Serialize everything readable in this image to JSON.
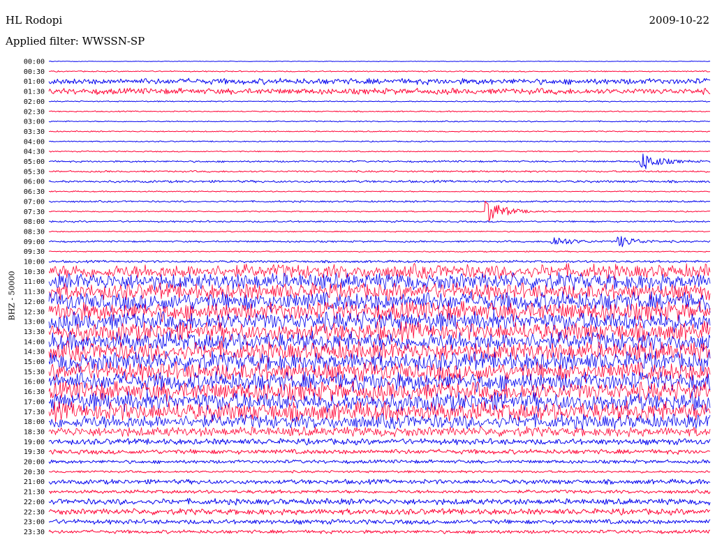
{
  "header": {
    "station": "HL Rodopi",
    "date": "2009-10-22",
    "filter": "Applied filter: WWSSN-SP",
    "channel": "BHZ - 50000"
  },
  "colors": {
    "a": "#0000ee",
    "b": "#ff0033",
    "text": "#000000"
  },
  "chart_data": {
    "type": "helicorder",
    "title": "HL Rodopi",
    "date": "2009-10-22",
    "filter": "WWSSN-SP",
    "ylabel": "BHZ - 50000",
    "row_minutes": 30,
    "tick_labels": [
      "00:00",
      "00:30",
      "01:00",
      "01:30",
      "02:00",
      "02:30",
      "03:00",
      "03:30",
      "04:00",
      "04:30",
      "05:00",
      "05:30",
      "06:00",
      "06:30",
      "07:00",
      "07:30",
      "08:00",
      "08:30",
      "09:00",
      "09:30",
      "10:00",
      "10:30",
      "11:00",
      "11:30",
      "12:00",
      "12:30",
      "13:00",
      "13:30",
      "14:00",
      "14:30",
      "15:00",
      "15:30",
      "16:00",
      "16:30",
      "17:00",
      "17:30",
      "18:00",
      "18:30",
      "19:00",
      "19:30",
      "20:00",
      "20:30",
      "21:00",
      "21:30",
      "22:00",
      "22:30",
      "23:00",
      "23:30"
    ],
    "row_colors": [
      "a",
      "b"
    ],
    "noise_level": [
      0.5,
      1,
      5,
      5,
      1,
      1,
      1,
      1,
      1,
      1,
      1.5,
      1.5,
      2,
      1,
      1.5,
      1,
      1.5,
      1,
      1.5,
      1,
      2,
      12,
      14,
      14,
      16,
      16,
      16,
      16,
      16,
      16,
      16,
      16,
      16,
      16,
      16,
      16,
      12,
      8,
      5,
      4,
      3,
      2,
      4,
      3,
      5,
      5,
      4,
      3
    ],
    "events": [
      {
        "label": "05:00",
        "at_minute": 27,
        "strength": 12
      },
      {
        "label": "07:30",
        "at_minute": 20,
        "strength": 16
      },
      {
        "label": "09:00",
        "at_minute": 23,
        "strength": 7
      },
      {
        "label": "09:00",
        "at_minute": 26,
        "strength": 7
      }
    ]
  }
}
